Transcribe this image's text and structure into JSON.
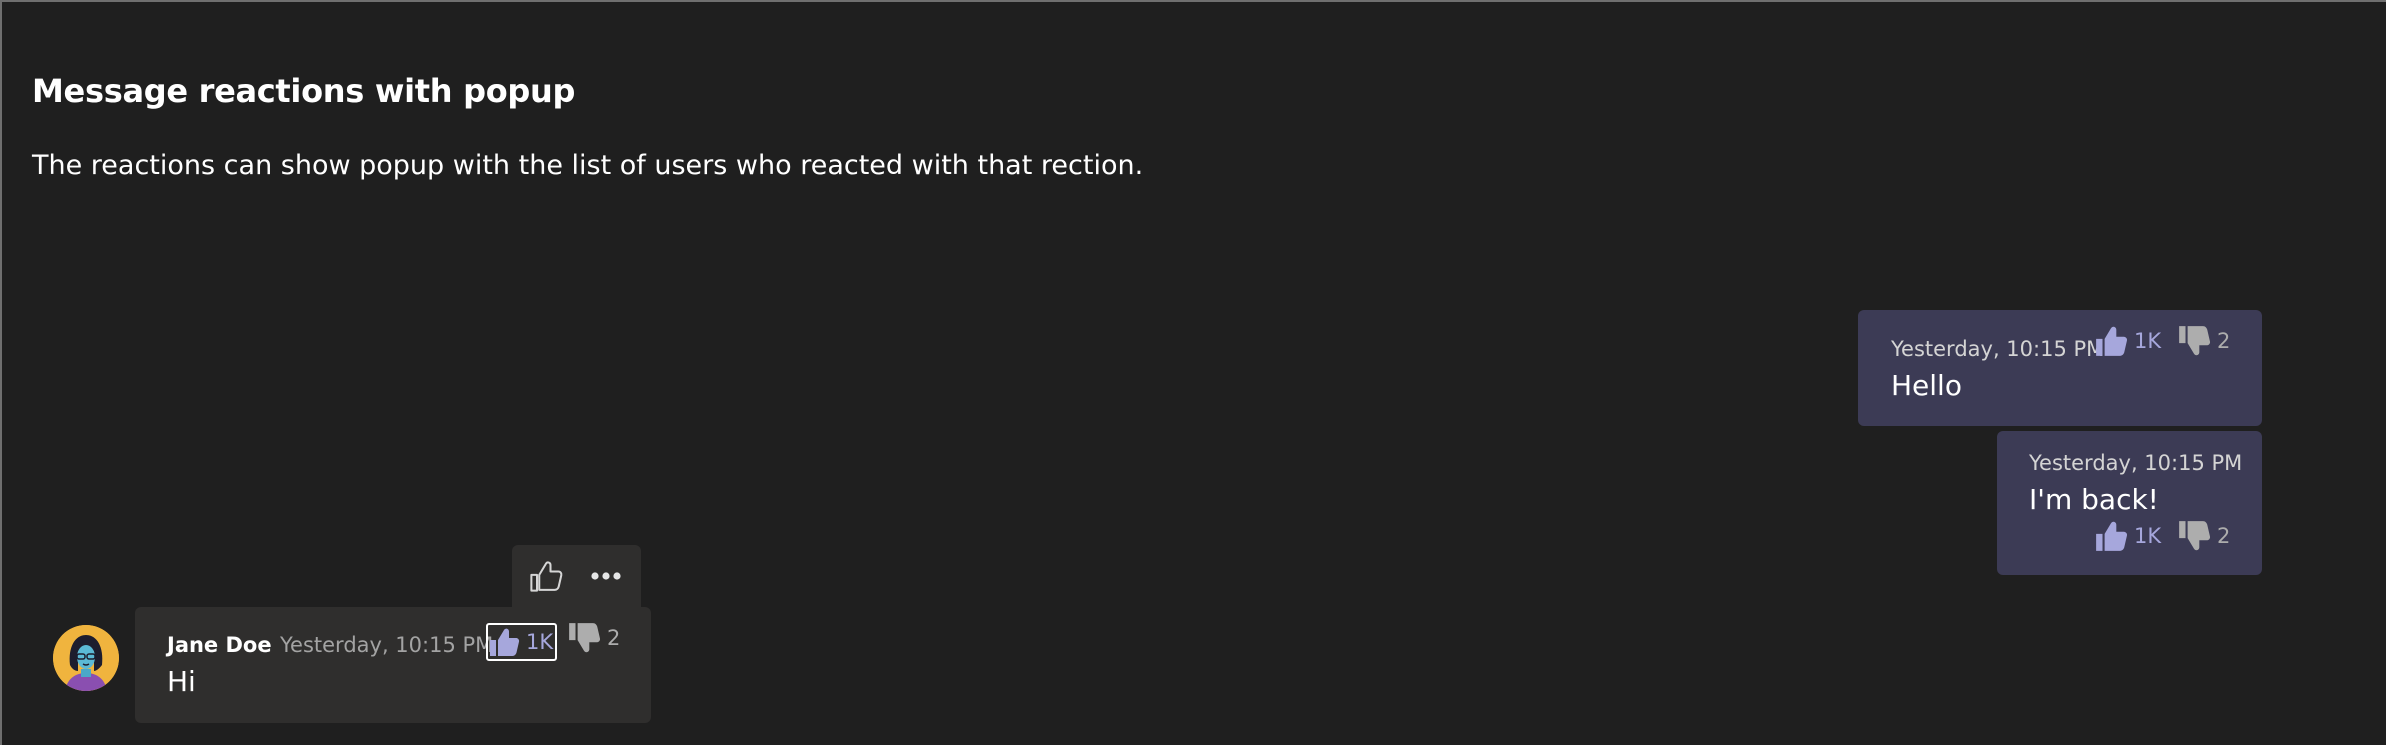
{
  "header": {
    "title": "Message reactions with popup",
    "description": "The reactions can show popup with the list of users who reacted with that rection."
  },
  "colors": {
    "background": "#1f1f1f",
    "mine_bubble": "#3c3b55",
    "their_bubble": "#2f2e2d",
    "like_accent": "#a6a7dc",
    "dislike": "#adadad",
    "avatar_bg": "#f0b43e"
  },
  "messages_mine": [
    {
      "timestamp": "Yesterday, 10:15 PM",
      "text": "Hello",
      "reactions": {
        "like_icon": "thumbs-up-icon",
        "like_count": "1K",
        "dislike_icon": "thumbs-down-icon",
        "dislike_count": "2"
      }
    },
    {
      "timestamp": "Yesterday, 10:15 PM",
      "text": "I'm back!",
      "reactions": {
        "like_icon": "thumbs-up-icon",
        "like_count": "1K",
        "dislike_icon": "thumbs-down-icon",
        "dislike_count": "2"
      }
    }
  ],
  "message_theirs": {
    "author": "Jane Doe",
    "timestamp": "Yesterday, 10:15 PM",
    "text": "Hi",
    "avatar_icon": "avatar-illustration",
    "reactions": {
      "like_icon": "thumbs-up-icon",
      "like_count": "1K",
      "like_focused": true,
      "dislike_icon": "thumbs-down-icon",
      "dislike_count": "2"
    },
    "actions": [
      {
        "icon": "thumbs-up-icon",
        "name": "like"
      },
      {
        "icon": "more-options-icon",
        "name": "more"
      }
    ]
  }
}
